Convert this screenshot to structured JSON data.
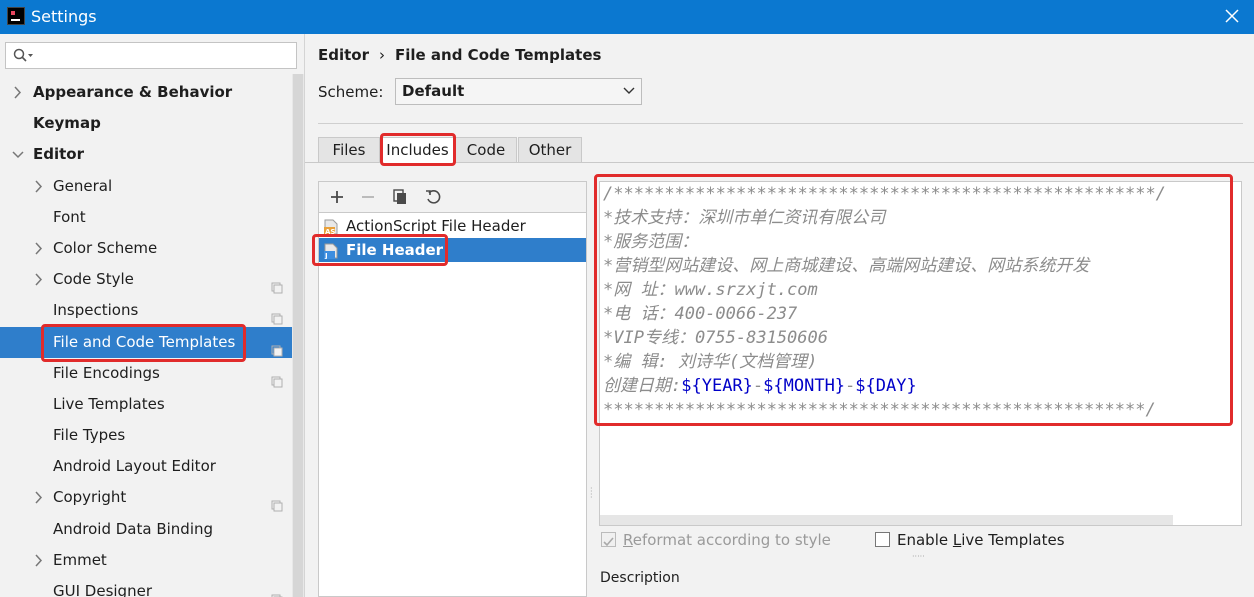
{
  "window": {
    "title": "Settings"
  },
  "sidebar": {
    "search_placeholder": "",
    "items": [
      {
        "label": "Appearance & Behavior",
        "level": 0,
        "expandable": true,
        "expanded": false
      },
      {
        "label": "Keymap",
        "level": 0,
        "expandable": false
      },
      {
        "label": "Editor",
        "level": 0,
        "expandable": true,
        "expanded": true
      },
      {
        "label": "General",
        "level": 1,
        "expandable": true,
        "expanded": false
      },
      {
        "label": "Font",
        "level": 1,
        "expandable": false
      },
      {
        "label": "Color Scheme",
        "level": 1,
        "expandable": true,
        "expanded": false
      },
      {
        "label": "Code Style",
        "level": 1,
        "expandable": true,
        "expanded": false,
        "page_icon": true
      },
      {
        "label": "Inspections",
        "level": 1,
        "expandable": false,
        "page_icon": true
      },
      {
        "label": "File and Code Templates",
        "level": 1,
        "expandable": false,
        "page_icon": true,
        "selected": true
      },
      {
        "label": "File Encodings",
        "level": 1,
        "expandable": false,
        "page_icon": true
      },
      {
        "label": "Live Templates",
        "level": 1,
        "expandable": false
      },
      {
        "label": "File Types",
        "level": 1,
        "expandable": false
      },
      {
        "label": "Android Layout Editor",
        "level": 1,
        "expandable": false
      },
      {
        "label": "Copyright",
        "level": 1,
        "expandable": true,
        "expanded": false,
        "page_icon": true
      },
      {
        "label": "Android Data Binding",
        "level": 1,
        "expandable": false
      },
      {
        "label": "Emmet",
        "level": 1,
        "expandable": true,
        "expanded": false
      },
      {
        "label": "GUI Designer",
        "level": 1,
        "expandable": false,
        "page_icon": true
      }
    ]
  },
  "breadcrumb": {
    "parent": "Editor",
    "separator": "›",
    "current": "File and Code Templates"
  },
  "scheme": {
    "label": "Scheme:",
    "value": "Default"
  },
  "tabs": [
    {
      "label": "Files",
      "active": false
    },
    {
      "label": "Includes",
      "active": true
    },
    {
      "label": "Code",
      "active": false
    },
    {
      "label": "Other",
      "active": false
    }
  ],
  "toolbar": {
    "add": "add-icon",
    "remove": "remove-icon",
    "copy": "copy-icon",
    "reset": "reset-icon"
  },
  "templates": [
    {
      "label": "ActionScript File Header",
      "icon": "actionscript-file-icon",
      "icon_text": "AS",
      "selected": false
    },
    {
      "label": "File Header",
      "icon": "java-file-icon",
      "icon_text": "J",
      "selected": true
    }
  ],
  "editor": {
    "lines": [
      "/*****************************************************/",
      "*技术支持：深圳市单仁资讯有限公司",
      "*服务范围：",
      "*营销型网站建设、网上商城建设、高端网站建设、网站系统开发",
      "*网 址：www.srzxjt.com",
      "*电 话：400-0066-237",
      "*VIP专线：0755-83150606",
      "*编 辑: 刘诗华(文档管理)"
    ],
    "date_prefix": "创建日期:",
    "var_year": "${YEAR}",
    "var_month": "${MONTH}",
    "var_day": "${DAY}",
    "date_sep": "-",
    "last_line": "*****************************************************/"
  },
  "options": {
    "reformat": {
      "label_pre": "",
      "label_u": "R",
      "label_post": "eformat according to style",
      "checked": true,
      "enabled": false
    },
    "enable_live": {
      "label_pre": "Enable ",
      "label_u": "L",
      "label_post": "ive Templates",
      "checked": false,
      "enabled": true
    }
  },
  "description_label": "Description",
  "colors": {
    "titlebar": "#0b78d0",
    "selection": "#2f7ecb",
    "highlight_box": "#e12b2b",
    "template_var": "#0000c8"
  }
}
